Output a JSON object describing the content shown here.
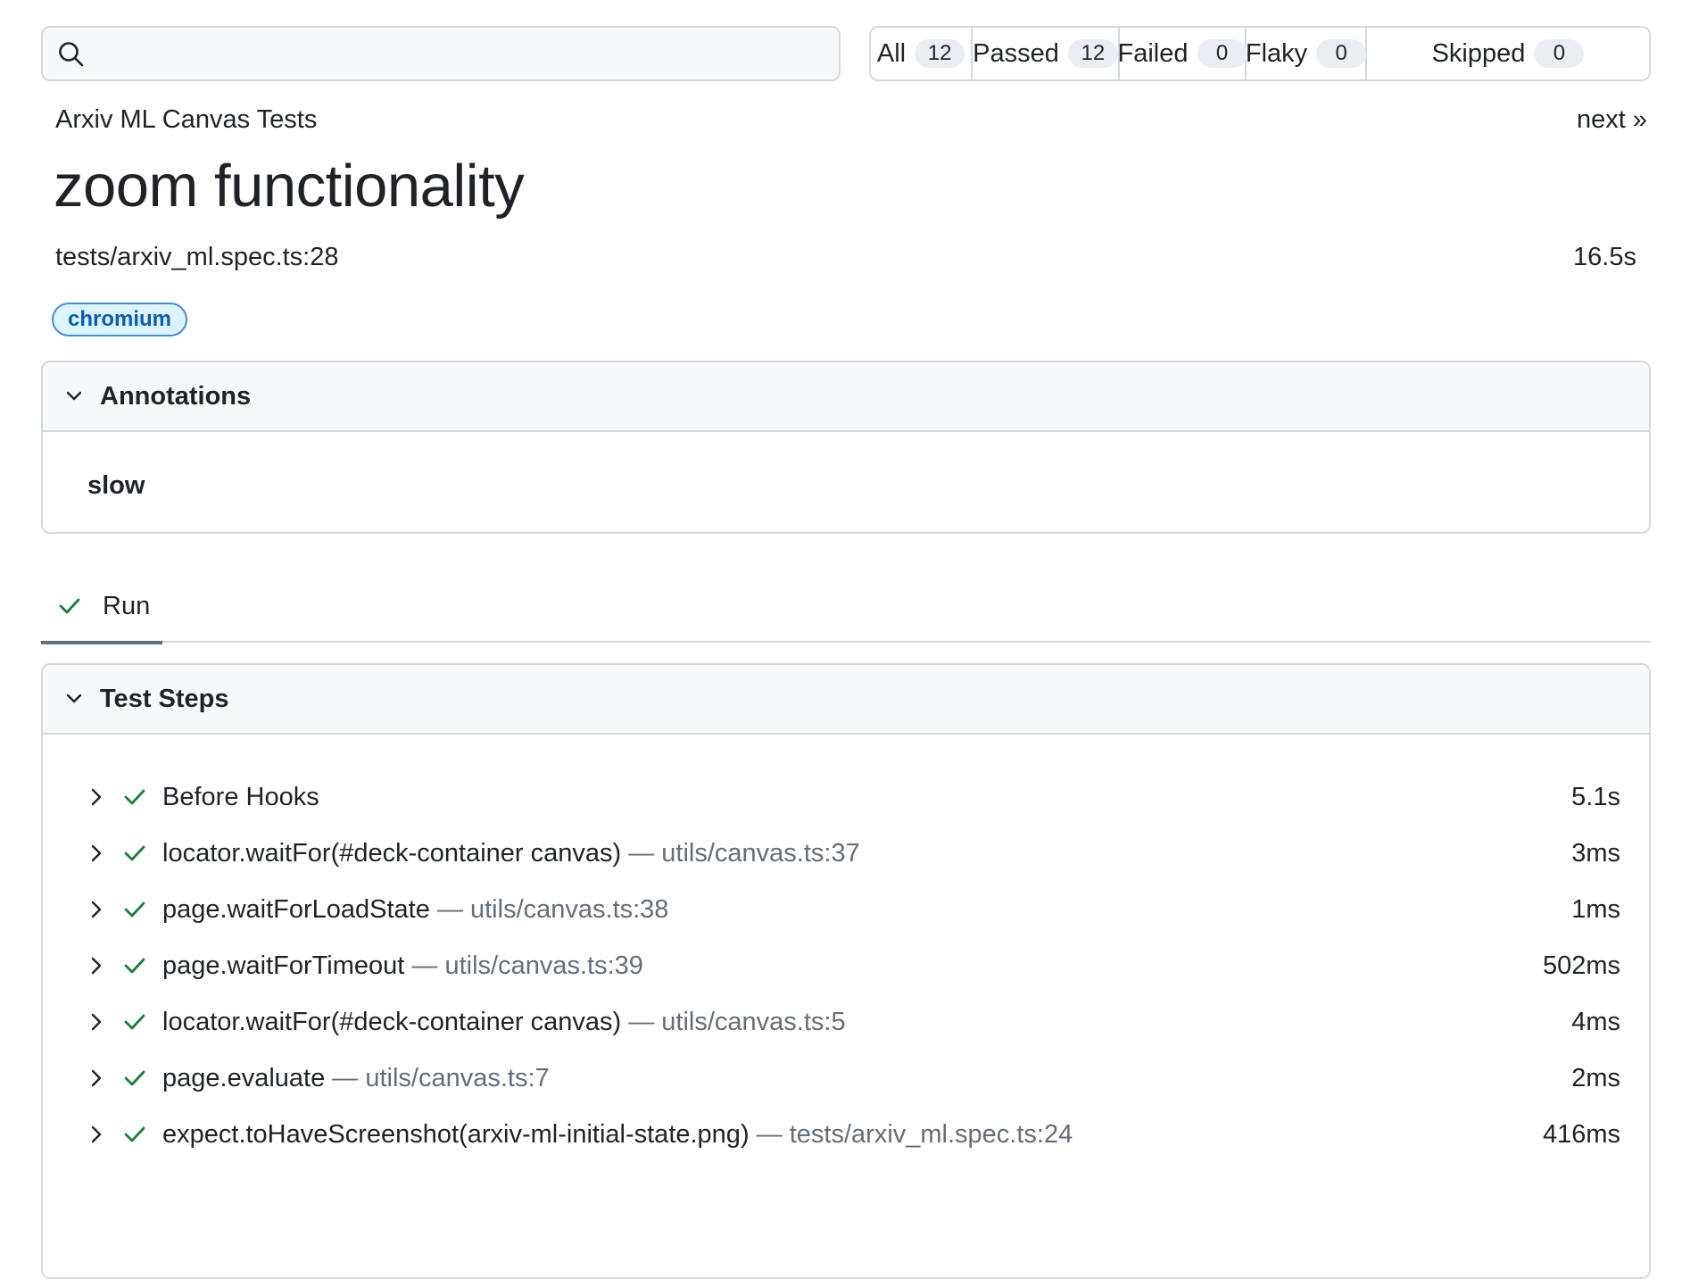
{
  "search": {
    "value": "",
    "placeholder": ""
  },
  "filters": [
    {
      "label": "All",
      "count": "12"
    },
    {
      "label": "Passed",
      "count": "12"
    },
    {
      "label": "Failed",
      "count": "0"
    },
    {
      "label": "Flaky",
      "count": "0"
    },
    {
      "label": "Skipped",
      "count": "0"
    }
  ],
  "header": {
    "project": "Arxiv ML Canvas Tests",
    "next_label": "next »",
    "title": "zoom functionality",
    "location": "tests/arxiv_ml.spec.ts:28",
    "duration": "16.5s",
    "tag": "chromium"
  },
  "annotations": {
    "title": "Annotations",
    "items": [
      "slow"
    ]
  },
  "tabs": [
    {
      "label": "Run",
      "status": "passed"
    }
  ],
  "steps": {
    "title": "Test Steps",
    "items": [
      {
        "title": "Before Hooks",
        "location": "",
        "duration": "5.1s"
      },
      {
        "title": "locator.waitFor(#deck-container canvas)",
        "location": "— utils/canvas.ts:37",
        "duration": "3ms"
      },
      {
        "title": "page.waitForLoadState",
        "location": "— utils/canvas.ts:38",
        "duration": "1ms"
      },
      {
        "title": "page.waitForTimeout",
        "location": "— utils/canvas.ts:39",
        "duration": "502ms"
      },
      {
        "title": "locator.waitFor(#deck-container canvas)",
        "location": "— utils/canvas.ts:5",
        "duration": "4ms"
      },
      {
        "title": "page.evaluate",
        "location": "— utils/canvas.ts:7",
        "duration": "2ms"
      },
      {
        "title": "expect.toHaveScreenshot(arxiv-ml-initial-state.png)",
        "location": "— tests/arxiv_ml.spec.ts:24",
        "duration": "416ms"
      }
    ]
  },
  "colors": {
    "pass": "#1a7f37",
    "tag_bg": "#ddf4ff",
    "tag_border": "#3f8be0",
    "tag_text": "#0a5bb5",
    "border": "#d1d9e0",
    "muted": "#656d76"
  },
  "icons": {
    "search": "search-icon",
    "chevron_down": "chevron-down-icon",
    "chevron_right": "chevron-right-icon",
    "check": "check-icon"
  }
}
